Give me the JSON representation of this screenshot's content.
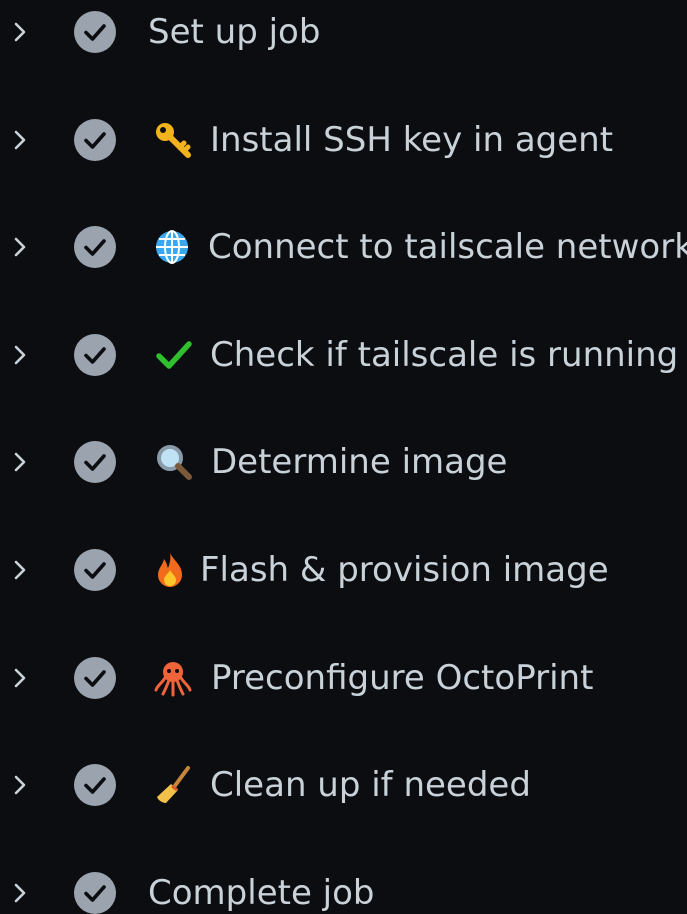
{
  "steps": [
    {
      "label": "Set up job",
      "status": "success",
      "emoji": "none"
    },
    {
      "label": "Install SSH key in agent",
      "status": "success",
      "emoji": "key-icon"
    },
    {
      "label": "Connect to tailscale network",
      "status": "success",
      "emoji": "globe-icon"
    },
    {
      "label": "Check if tailscale is running",
      "status": "success",
      "emoji": "checkmark-icon"
    },
    {
      "label": "Determine image",
      "status": "success",
      "emoji": "magnifier-icon"
    },
    {
      "label": "Flash & provision image",
      "status": "success",
      "emoji": "fire-icon"
    },
    {
      "label": "Preconfigure OctoPrint",
      "status": "success",
      "emoji": "octopus-icon"
    },
    {
      "label": "Clean up if needed",
      "status": "success",
      "emoji": "broom-icon"
    },
    {
      "label": "Complete job",
      "status": "success",
      "emoji": "none"
    }
  ],
  "colors": {
    "background": "#0b0d11",
    "text": "#c9d1d9",
    "chevron": "#c9d1d9",
    "check_circle": "#9ba3af",
    "check_mark": "#0b0d11"
  }
}
